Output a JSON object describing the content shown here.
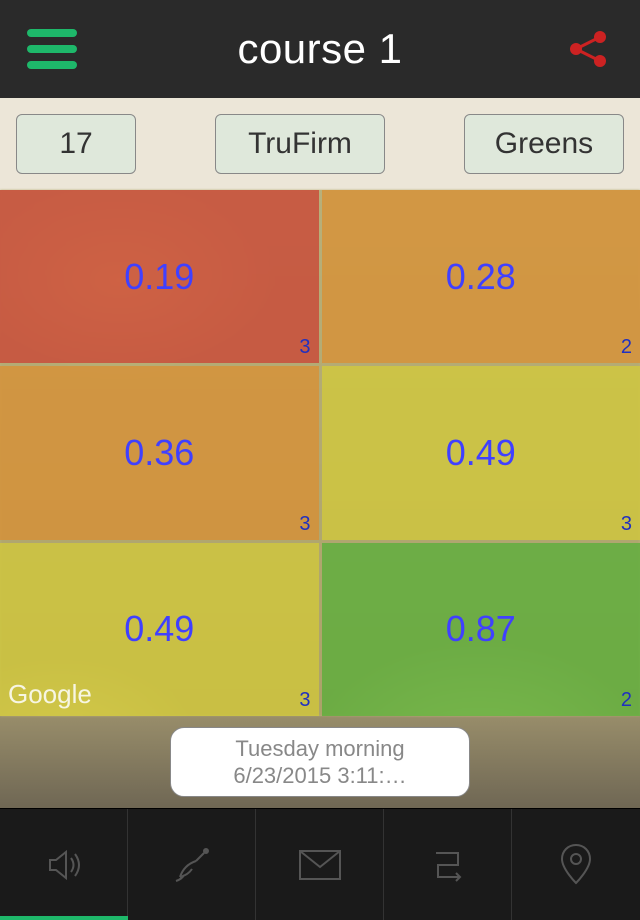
{
  "header": {
    "title": "course 1"
  },
  "filters": {
    "left": "17",
    "mid": "TruFirm",
    "right": "Greens"
  },
  "cells": [
    {
      "value": "0.19",
      "count": "3",
      "color": "red"
    },
    {
      "value": "0.28",
      "count": "2",
      "color": "orange"
    },
    {
      "value": "0.36",
      "count": "3",
      "color": "orange"
    },
    {
      "value": "0.49",
      "count": "3",
      "color": "yellow"
    },
    {
      "value": "0.49",
      "count": "3",
      "color": "yellow"
    },
    {
      "value": "0.87",
      "count": "2",
      "color": "green"
    }
  ],
  "map_attribution": "Google",
  "date": {
    "line1": "Tuesday morning",
    "line2": "6/23/2015 3:11:…"
  },
  "chart_data": {
    "type": "heatmap",
    "title": "TruFirm readings — course 1, hole 17, Greens",
    "grid_shape": [
      3,
      2
    ],
    "values": [
      [
        0.19,
        0.28
      ],
      [
        0.36,
        0.49
      ],
      [
        0.49,
        0.87
      ]
    ],
    "sample_counts": [
      [
        3,
        2
      ],
      [
        3,
        3
      ],
      [
        3,
        2
      ]
    ],
    "color_scale": [
      "red",
      "orange",
      "yellow",
      "green"
    ],
    "value_range_observed": [
      0.19,
      0.87
    ],
    "timestamp_label": "Tuesday morning 6/23/2015 3:11"
  }
}
